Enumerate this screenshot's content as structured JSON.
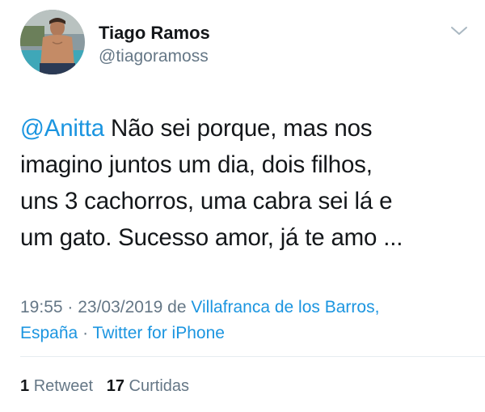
{
  "author": {
    "name": "Tiago Ramos",
    "handle": "@tiagoramoss"
  },
  "tweet": {
    "mention": "@Anitta",
    "line1_rest": " Não sei porque, mas nos",
    "line2": "imagino juntos um dia, dois filhos,",
    "line3": "uns 3 cachorros, uma cabra sei lá e",
    "line4": "um gato. Sucesso amor, já te amo ..."
  },
  "meta": {
    "time_date": "19:55 · 23/03/2019",
    "from_word": " de ",
    "location_part1": "Villafranca de los Barros,",
    "location_part2": "España",
    "separator": " · ",
    "source": "Twitter for iPhone"
  },
  "stats": {
    "retweets_count": "1",
    "retweets_label": "Retweet",
    "likes_count": "17",
    "likes_label": "Curtidas"
  },
  "colors": {
    "link": "#1b95e0",
    "secondary_text": "#657786",
    "primary_text": "#14171a"
  },
  "icons": {
    "menu": "chevron-down-icon"
  }
}
